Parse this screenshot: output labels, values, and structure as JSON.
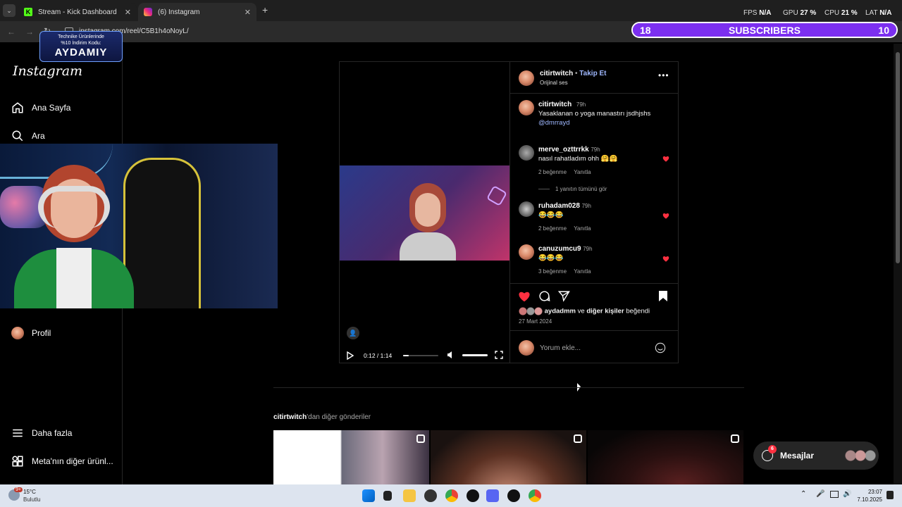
{
  "browser": {
    "tabs": [
      {
        "label": "Stream - Kick Dashboard",
        "active": false
      },
      {
        "label": "(6) Instagram",
        "active": true
      }
    ],
    "url": "instagram.com/reel/C5B1h4oNoyL/",
    "stats": {
      "fps_label": "FPS",
      "fps": "N/A",
      "gpu_label": "GPU",
      "gpu": "27 %",
      "cpu_label": "CPU",
      "cpu": "21 %",
      "lat_label": "LAT",
      "lat": "N/A"
    }
  },
  "subscribers": {
    "current": "18",
    "label": "SUBSCRIBERS",
    "goal": "10",
    "progress": 1.0
  },
  "promo": {
    "line1": "Technike Ürünlerinde",
    "line2": "%10 İndirim Kodu:",
    "code": "AYDAMIY"
  },
  "sidebar": {
    "logo": "Instagram",
    "items": [
      {
        "label": "Ana Sayfa",
        "icon": "home-icon"
      },
      {
        "label": "Ara",
        "icon": "search-icon"
      },
      {
        "label": "Profil",
        "icon": "avatar"
      },
      {
        "label": "Daha fazla",
        "icon": "menu-icon"
      },
      {
        "label": "Meta'nın diğer ürünl...",
        "icon": "grid-icon"
      }
    ]
  },
  "post": {
    "author": "citirtwitch",
    "follow": "Takip Et",
    "audio": "Orijinal ses",
    "caption": {
      "user": "citirtwitch",
      "time": "79h",
      "text": "Yasaklanan o yoga manastırı jsdhjshs",
      "mention": "@dmrrayd"
    },
    "comments": [
      {
        "user": "merve_ozttrrkk",
        "time": "79h",
        "text": "nasıl rahatladım ohh 🤗🤗",
        "likes": "2 beğenme",
        "reply": "Yanıtla",
        "thread": "1 yanıtın tümünü gör"
      },
      {
        "user": "ruhadam028",
        "time": "79h",
        "text": "😂😂😂",
        "likes": "2 beğenme",
        "reply": "Yanıtla"
      },
      {
        "user": "canuzumcu9",
        "time": "79h",
        "text": "😂😂😂",
        "likes": "3 beğenme",
        "reply": "Yanıtla"
      }
    ],
    "liked_by": {
      "user": "aydadmm",
      "mid": "ve",
      "others": "diğer kişiler",
      "suffix": "beğendi"
    },
    "date": "27 Mart 2024",
    "comment_placeholder": "Yorum ekle...",
    "video": {
      "time": "0:12 / 1:14",
      "progress": 0.16
    }
  },
  "more_posts": {
    "user": "citirtwitch",
    "suffix": "'dan diğer gönderiler"
  },
  "messages": {
    "label": "Mesajlar",
    "badge": "6"
  },
  "taskbar": {
    "temp": "15°C",
    "weather": "Bulutlu",
    "weather_badge": "9+",
    "time": "23:07",
    "date": "7.10.2025"
  },
  "colors": {
    "accent_purple": "#5b21b6",
    "heart": "#ff3040",
    "link": "#e0f1ff"
  }
}
